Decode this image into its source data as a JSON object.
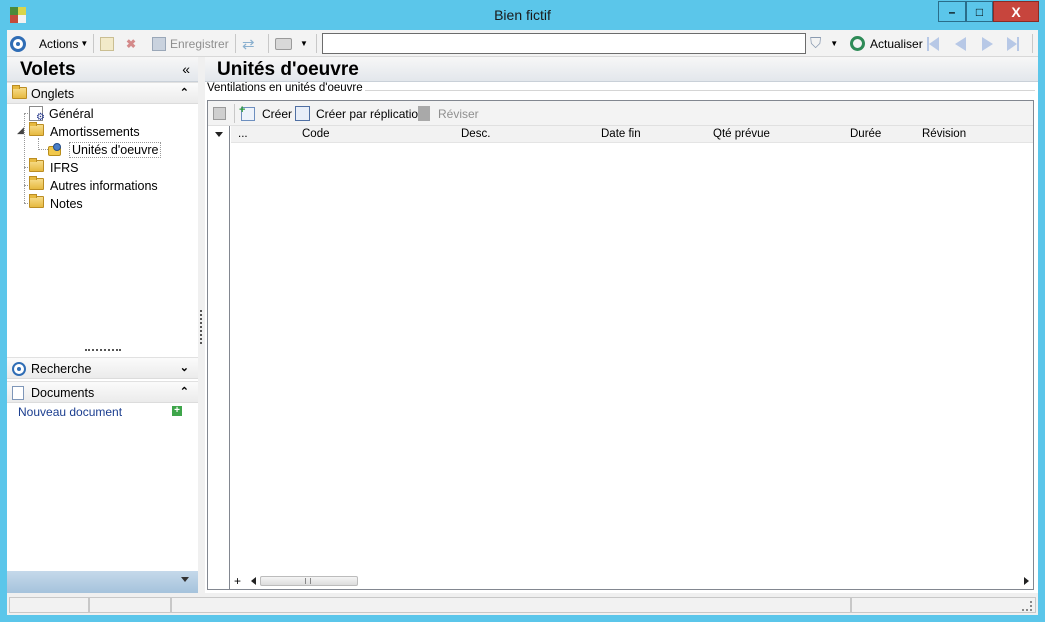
{
  "window": {
    "title": "Bien fictif",
    "close_symbol": "X",
    "maximize_symbol": "□",
    "minimize_symbol": "–"
  },
  "toolbar": {
    "actions_label": "Actions",
    "save_label": "Enregistrer",
    "search_value": "",
    "refresh_label": "Actualiser"
  },
  "left_pane": {
    "title": "Volets",
    "collapse_symbol": "«",
    "onglets_label": "Onglets",
    "tree": [
      {
        "label": "Général",
        "icon": "settings-doc-icon"
      },
      {
        "label": "Amortissements",
        "icon": "folder-icon"
      },
      {
        "label": "Unités d'oeuvre",
        "icon": "units-icon"
      },
      {
        "label": "IFRS",
        "icon": "folder-icon"
      },
      {
        "label": "Autres informations",
        "icon": "folder-icon"
      },
      {
        "label": "Notes",
        "icon": "folder-icon"
      }
    ],
    "recherche_label": "Recherche",
    "documents_label": "Documents",
    "new_document_label": "Nouveau document",
    "expand_symbol": "»",
    "chevron_up": "«"
  },
  "main": {
    "title": "Unités d'oeuvre",
    "group_label": "Ventilations en unités d'oeuvre",
    "grid_toolbar": {
      "create_label": "Créer",
      "create_replication_label": "Créer par réplication",
      "revise_label": "Réviser"
    },
    "columns": [
      "...",
      "Code",
      "Desc.",
      "Date fin",
      "Qté prévue",
      "Durée",
      "Révision"
    ],
    "add_row_symbol": "+"
  },
  "colors": {
    "chrome": "#5bc6ea",
    "accent_blue": "#2f6db5",
    "link": "#1a3d8f"
  }
}
